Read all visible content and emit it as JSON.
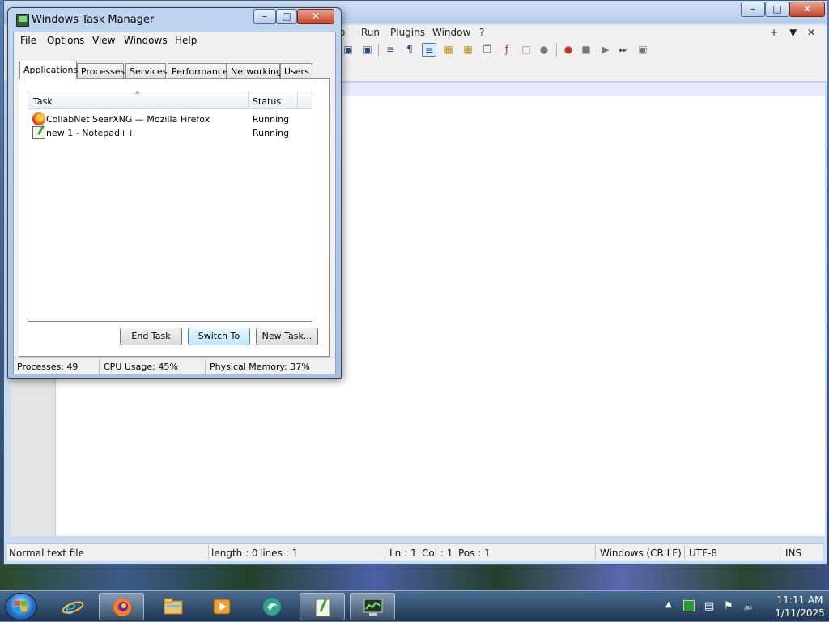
{
  "notepadpp": {
    "menu_items": [
      "o",
      "Run",
      "Plugins",
      "Window",
      "?"
    ],
    "status": {
      "file_type": "Normal text file",
      "length": "length : 0",
      "lines": "lines : 1",
      "ln": "Ln : 1",
      "col": "Col : 1",
      "pos": "Pos : 1",
      "eol": "Windows (CR LF)",
      "encoding": "UTF-8",
      "mode": "INS"
    }
  },
  "task_manager": {
    "title": "Windows Task Manager",
    "menu": [
      "File",
      "Options",
      "View",
      "Windows",
      "Help"
    ],
    "tabs": [
      "Applications",
      "Processes",
      "Services",
      "Performance",
      "Networking",
      "Users"
    ],
    "active_tab": "Applications",
    "columns": {
      "task": "Task",
      "status": "Status"
    },
    "rows": [
      {
        "task": "CollabNet SearXNG — Mozilla Firefox",
        "status": "Running",
        "icon": "firefox-icon"
      },
      {
        "task": "new 1 - Notepad++",
        "status": "Running",
        "icon": "notepad-icon"
      }
    ],
    "buttons": {
      "end_task": "End Task",
      "switch_to": "Switch To",
      "new_task": "New Task..."
    },
    "status": {
      "processes": "Processes: 49",
      "cpu": "CPU Usage: 45%",
      "memory": "Physical Memory: 37%"
    }
  },
  "taskbar": {
    "items": [
      "start-button",
      "internet-explorer-icon",
      "firefox-icon",
      "file-explorer-icon",
      "media-player-icon",
      "app-icon",
      "notepadpp-icon",
      "task-manager-icon"
    ],
    "clock": {
      "time": "11:11 AM",
      "date": "1/11/2025"
    }
  },
  "colors": {
    "accent": "#3c7fb1",
    "taskbar": "#1f3550",
    "close": "#c4452a"
  }
}
